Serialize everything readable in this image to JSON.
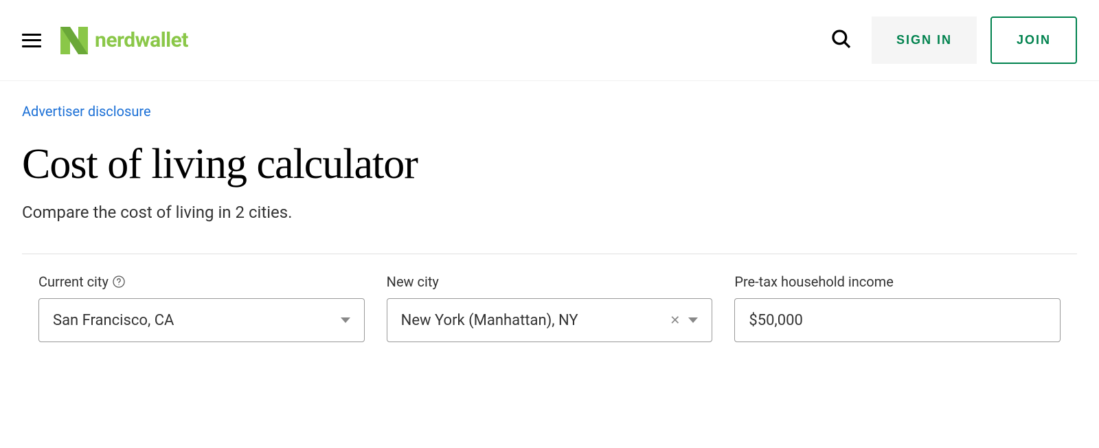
{
  "header": {
    "logo_text": "nerdwallet",
    "signin_label": "SIGN IN",
    "join_label": "JOIN"
  },
  "disclosure": "Advertiser disclosure",
  "page_title": "Cost of living calculator",
  "subtitle": "Compare the cost of living in 2 cities.",
  "form": {
    "current_city": {
      "label": "Current city",
      "value": "San Francisco, CA"
    },
    "new_city": {
      "label": "New city",
      "value": "New York (Manhattan), NY"
    },
    "income": {
      "label": "Pre-tax household income",
      "value": "$50,000"
    }
  }
}
